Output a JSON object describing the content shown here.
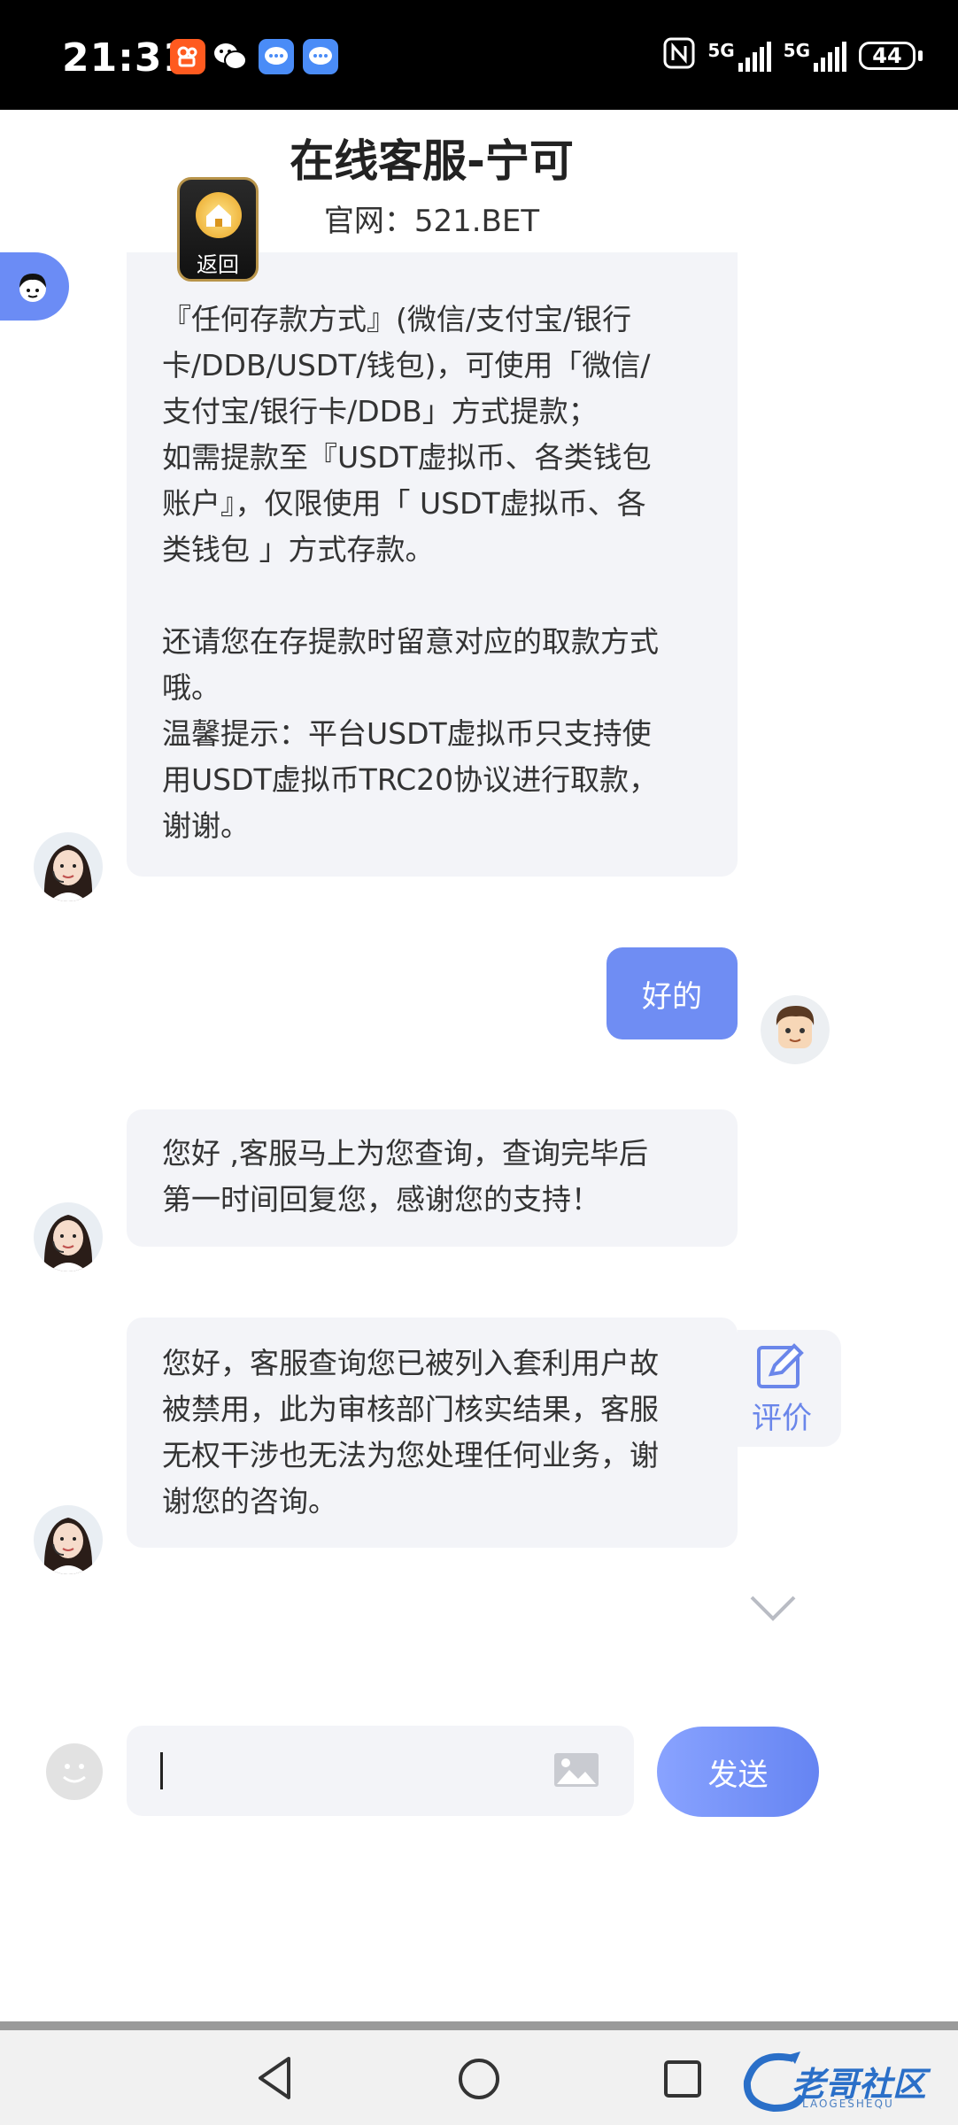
{
  "status_bar": {
    "time": "21:31",
    "network_1": "5G",
    "network_2": "5G",
    "battery": "44",
    "notification_icons": [
      "kuaishou-icon",
      "wechat-icon",
      "message-icon",
      "message-icon"
    ]
  },
  "header": {
    "title": "在线客服-宁可",
    "site": "官网：521.BET",
    "back_label": "返回"
  },
  "messages": {
    "agent_1": {
      "lines": [
        "『任何存款方式』(微信/支付宝/银行",
        "卡/DDB/USDT/钱包)，可使用「微信/",
        "支付宝/银行卡/DDB」方式提款；",
        "如需提款至『USDT虚拟币、各类钱包",
        "账户』，仅限使用「 USDT虚拟币、各",
        "类钱包 」方式存款。",
        "",
        "还请您在存提款时留意对应的取款方式",
        "哦。",
        "温馨提示：平台USDT虚拟币只支持使",
        "用USDT虚拟币TRC20协议进行取款，",
        "谢谢。"
      ]
    },
    "user_1": {
      "text": "好的"
    },
    "agent_2": {
      "lines": [
        "您好 ,客服马上为您查询，查询完毕后",
        "第一时间回复您，感谢您的支持！"
      ]
    },
    "agent_3": {
      "lines": [
        "您好，客服查询您已被列入套利用户故",
        "被禁用，此为审核部门核实结果，客服",
        "无权干涉也无法为您处理任何业务，谢",
        "谢您的咨询。"
      ]
    }
  },
  "rate_button": {
    "label": "评价"
  },
  "composer": {
    "placeholder": "",
    "send_label": "发送"
  },
  "watermark": {
    "text": "老哥社区",
    "sub": "LAOGESHEQU"
  },
  "colors": {
    "accent": "#6f8df3",
    "bubble_bg": "#f3f4f8",
    "status_bar": "#000000"
  }
}
